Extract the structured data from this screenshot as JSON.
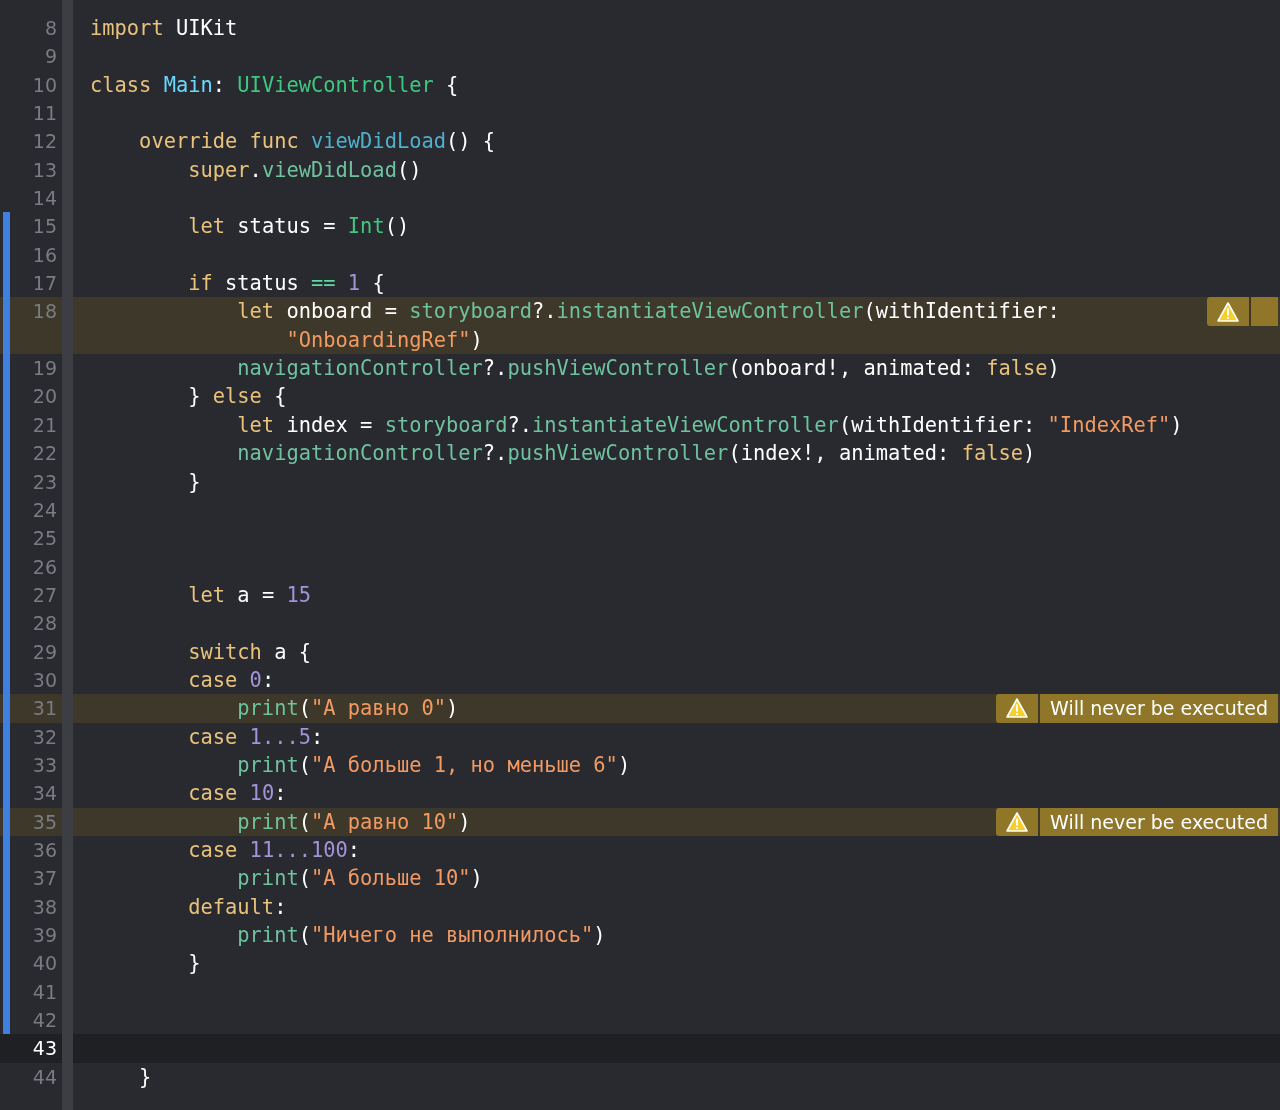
{
  "editor": {
    "lines": [
      {
        "number": "8",
        "changed": false,
        "current": false,
        "tokens": [
          {
            "kind": "keyword",
            "text": "import"
          },
          {
            "kind": "plain",
            "text": " UIKit"
          }
        ]
      },
      {
        "number": "9",
        "changed": false,
        "current": false
      },
      {
        "number": "10",
        "changed": false,
        "current": false,
        "tokens": [
          {
            "kind": "keyword",
            "text": "class"
          },
          {
            "kind": "declaration",
            "text": " Main"
          },
          {
            "kind": "plain",
            "text": ":"
          },
          {
            "kind": "type",
            "text": " UIViewController"
          },
          {
            "kind": "plain",
            "text": " {"
          }
        ]
      },
      {
        "number": "11",
        "changed": false,
        "current": false
      },
      {
        "number": "12",
        "changed": false,
        "current": false,
        "tokens": [
          {
            "kind": "keyword",
            "text": "    override func"
          },
          {
            "kind": "function",
            "text": " viewDidLoad"
          },
          {
            "kind": "plain",
            "text": "() {"
          }
        ]
      },
      {
        "number": "13",
        "changed": false,
        "current": false,
        "tokens": [
          {
            "kind": "keyword",
            "text": "        super"
          },
          {
            "kind": "plain",
            "text": "."
          },
          {
            "kind": "member",
            "text": "viewDidLoad"
          },
          {
            "kind": "plain",
            "text": "()"
          }
        ]
      },
      {
        "number": "14",
        "changed": false,
        "current": false
      },
      {
        "number": "15",
        "changed": true,
        "current": false,
        "tokens": [
          {
            "kind": "keyword",
            "text": "        let"
          },
          {
            "kind": "plain",
            "text": " status ="
          },
          {
            "kind": "type",
            "text": " Int"
          },
          {
            "kind": "plain",
            "text": "()"
          }
        ]
      },
      {
        "number": "16",
        "changed": true,
        "current": false
      },
      {
        "number": "17",
        "changed": true,
        "current": false,
        "tokens": [
          {
            "kind": "keyword",
            "text": "        if"
          },
          {
            "kind": "plain",
            "text": " status"
          },
          {
            "kind": "operator",
            "text": " =="
          },
          {
            "kind": "number",
            "text": " 1"
          },
          {
            "kind": "plain",
            "text": " {"
          }
        ]
      },
      {
        "number": "18",
        "changed": true,
        "current": false,
        "warning": {
          "expanded": false
        },
        "tokens": [
          {
            "kind": "keyword",
            "text": "            let"
          },
          {
            "kind": "plain",
            "text": " onboard ="
          },
          {
            "kind": "member",
            "text": " storyboard"
          },
          {
            "kind": "plain",
            "text": "?."
          },
          {
            "kind": "member",
            "text": "instantiateViewController"
          },
          {
            "kind": "plain",
            "text": "(withIdentifier:"
          }
        ],
        "wrap": [
          {
            "kind": "string",
            "text": "                \"OnboardingRef\""
          },
          {
            "kind": "plain",
            "text": ")"
          }
        ]
      },
      {
        "number": "19",
        "changed": true,
        "current": false,
        "tokens": [
          {
            "kind": "member",
            "text": "            navigationController"
          },
          {
            "kind": "plain",
            "text": "?."
          },
          {
            "kind": "member",
            "text": "pushViewController"
          },
          {
            "kind": "plain",
            "text": "(onboard!, animated:"
          },
          {
            "kind": "keyword",
            "text": " false"
          },
          {
            "kind": "plain",
            "text": ")"
          }
        ]
      },
      {
        "number": "20",
        "changed": true,
        "current": false,
        "tokens": [
          {
            "kind": "plain",
            "text": "        }"
          },
          {
            "kind": "keyword",
            "text": " else"
          },
          {
            "kind": "plain",
            "text": " {"
          }
        ]
      },
      {
        "number": "21",
        "changed": true,
        "current": false,
        "tokens": [
          {
            "kind": "keyword",
            "text": "            let"
          },
          {
            "kind": "plain",
            "text": " index ="
          },
          {
            "kind": "member",
            "text": " storyboard"
          },
          {
            "kind": "plain",
            "text": "?."
          },
          {
            "kind": "member",
            "text": "instantiateViewController"
          },
          {
            "kind": "plain",
            "text": "(withIdentifier:"
          },
          {
            "kind": "string",
            "text": " \"IndexRef\""
          },
          {
            "kind": "plain",
            "text": ")"
          }
        ]
      },
      {
        "number": "22",
        "changed": true,
        "current": false,
        "tokens": [
          {
            "kind": "member",
            "text": "            navigationController"
          },
          {
            "kind": "plain",
            "text": "?."
          },
          {
            "kind": "member",
            "text": "pushViewController"
          },
          {
            "kind": "plain",
            "text": "(index!, animated:"
          },
          {
            "kind": "keyword",
            "text": " false"
          },
          {
            "kind": "plain",
            "text": ")"
          }
        ]
      },
      {
        "number": "23",
        "changed": true,
        "current": false,
        "tokens": [
          {
            "kind": "plain",
            "text": "        }"
          }
        ]
      },
      {
        "number": "24",
        "changed": true,
        "current": false
      },
      {
        "number": "25",
        "changed": true,
        "current": false
      },
      {
        "number": "26",
        "changed": true,
        "current": false
      },
      {
        "number": "27",
        "changed": true,
        "current": false,
        "tokens": [
          {
            "kind": "keyword",
            "text": "        let"
          },
          {
            "kind": "plain",
            "text": " a ="
          },
          {
            "kind": "number",
            "text": " 15"
          }
        ]
      },
      {
        "number": "28",
        "changed": true,
        "current": false
      },
      {
        "number": "29",
        "changed": true,
        "current": false,
        "tokens": [
          {
            "kind": "keyword",
            "text": "        switch"
          },
          {
            "kind": "plain",
            "text": " a {"
          }
        ]
      },
      {
        "number": "30",
        "changed": true,
        "current": false,
        "tokens": [
          {
            "kind": "keyword",
            "text": "        case"
          },
          {
            "kind": "number",
            "text": " 0"
          },
          {
            "kind": "plain",
            "text": ":"
          }
        ]
      },
      {
        "number": "31",
        "changed": true,
        "current": false,
        "warning": {
          "expanded": true,
          "message": "Will never be executed"
        },
        "tokens": [
          {
            "kind": "member",
            "text": "            print"
          },
          {
            "kind": "plain",
            "text": "("
          },
          {
            "kind": "string",
            "text": "\"А равно 0\""
          },
          {
            "kind": "plain",
            "text": ")"
          }
        ]
      },
      {
        "number": "32",
        "changed": true,
        "current": false,
        "tokens": [
          {
            "kind": "keyword",
            "text": "        case"
          },
          {
            "kind": "number",
            "text": " 1...5"
          },
          {
            "kind": "plain",
            "text": ":"
          }
        ]
      },
      {
        "number": "33",
        "changed": true,
        "current": false,
        "tokens": [
          {
            "kind": "member",
            "text": "            print"
          },
          {
            "kind": "plain",
            "text": "("
          },
          {
            "kind": "string",
            "text": "\"А больше 1, но меньше 6\""
          },
          {
            "kind": "plain",
            "text": ")"
          }
        ]
      },
      {
        "number": "34",
        "changed": true,
        "current": false,
        "tokens": [
          {
            "kind": "keyword",
            "text": "        case"
          },
          {
            "kind": "number",
            "text": " 10"
          },
          {
            "kind": "plain",
            "text": ":"
          }
        ]
      },
      {
        "number": "35",
        "changed": true,
        "current": false,
        "warning": {
          "expanded": true,
          "message": "Will never be executed"
        },
        "tokens": [
          {
            "kind": "member",
            "text": "            print"
          },
          {
            "kind": "plain",
            "text": "("
          },
          {
            "kind": "string",
            "text": "\"А равно 10\""
          },
          {
            "kind": "plain",
            "text": ")"
          }
        ]
      },
      {
        "number": "36",
        "changed": true,
        "current": false,
        "tokens": [
          {
            "kind": "keyword",
            "text": "        case"
          },
          {
            "kind": "number",
            "text": " 11...100"
          },
          {
            "kind": "plain",
            "text": ":"
          }
        ]
      },
      {
        "number": "37",
        "changed": true,
        "current": false,
        "tokens": [
          {
            "kind": "member",
            "text": "            print"
          },
          {
            "kind": "plain",
            "text": "("
          },
          {
            "kind": "string",
            "text": "\"А больше 10\""
          },
          {
            "kind": "plain",
            "text": ")"
          }
        ]
      },
      {
        "number": "38",
        "changed": true,
        "current": false,
        "tokens": [
          {
            "kind": "keyword",
            "text": "        default"
          },
          {
            "kind": "plain",
            "text": ":"
          }
        ]
      },
      {
        "number": "39",
        "changed": true,
        "current": false,
        "tokens": [
          {
            "kind": "member",
            "text": "            print"
          },
          {
            "kind": "plain",
            "text": "("
          },
          {
            "kind": "string",
            "text": "\"Ничего не выполнилось\""
          },
          {
            "kind": "plain",
            "text": ")"
          }
        ]
      },
      {
        "number": "40",
        "changed": true,
        "current": false,
        "tokens": [
          {
            "kind": "plain",
            "text": "        }"
          }
        ]
      },
      {
        "number": "41",
        "changed": true,
        "current": false
      },
      {
        "number": "42",
        "changed": true,
        "current": false
      },
      {
        "number": "43",
        "changed": false,
        "current": true
      },
      {
        "number": "44",
        "changed": false,
        "current": false,
        "tokens": [
          {
            "kind": "plain",
            "text": "    }"
          }
        ]
      }
    ]
  }
}
